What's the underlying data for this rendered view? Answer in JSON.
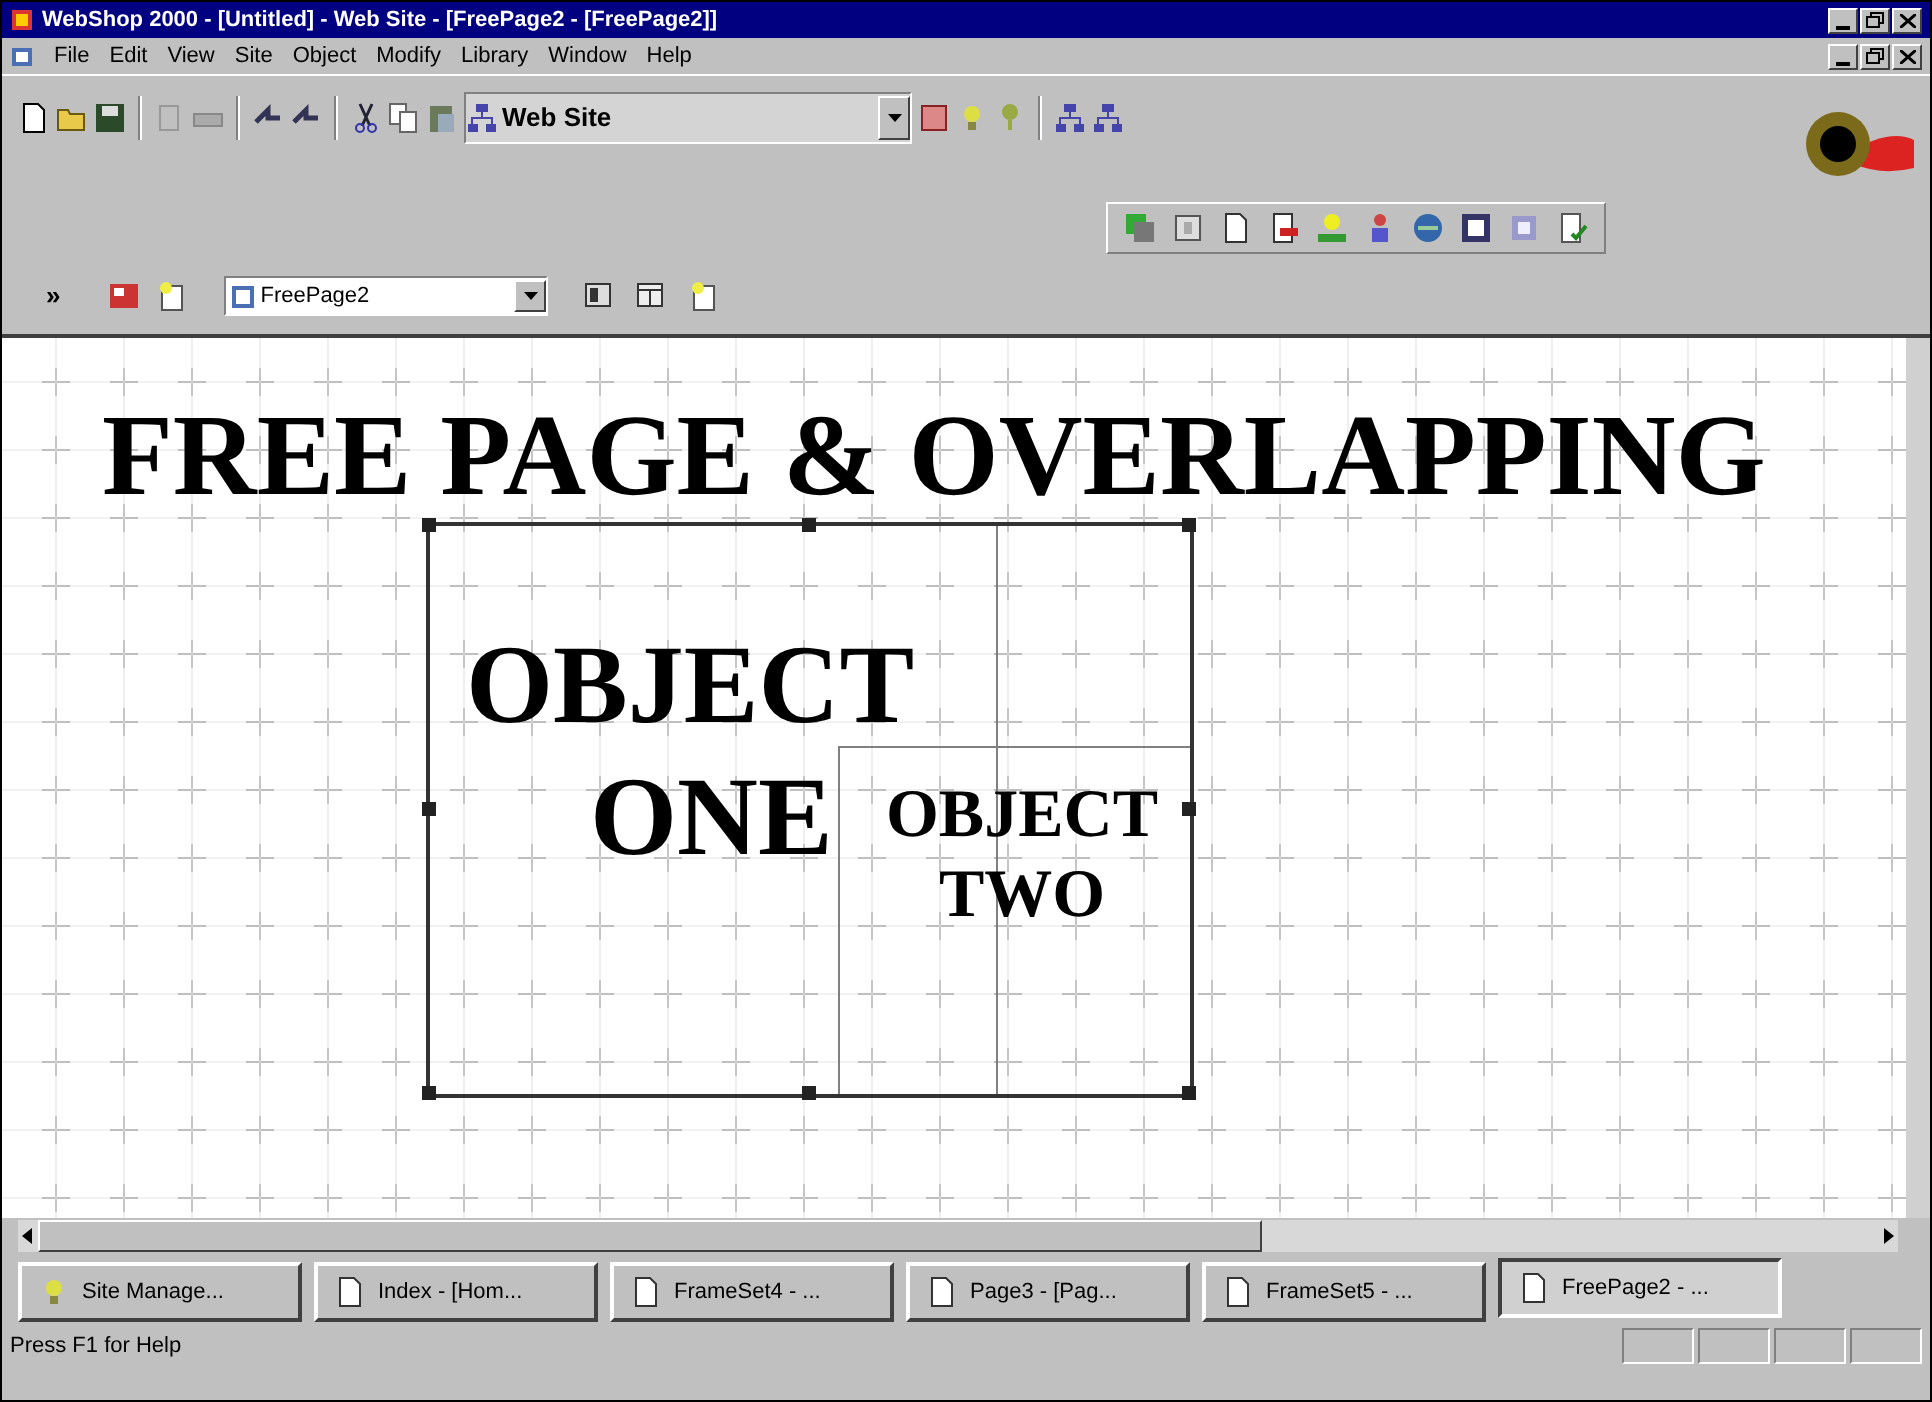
{
  "window": {
    "title": "WebShop 2000 - [Untitled] - Web Site - [FreePage2 - [FreePage2]]"
  },
  "menu": [
    "File",
    "Edit",
    "View",
    "Site",
    "Object",
    "Modify",
    "Library",
    "Window",
    "Help"
  ],
  "toolbar": {
    "view_combo": "Web Site"
  },
  "page_bar": {
    "chevron": "»",
    "page_combo": "FreePage2"
  },
  "canvas": {
    "heading": "FREE PAGE & OVERLAPPING",
    "objects": [
      {
        "lines": [
          "OBJECT",
          "ONE"
        ]
      },
      {
        "lines": [
          "OBJECT",
          "TWO"
        ]
      }
    ]
  },
  "tabs": [
    {
      "label": "Site Manage...",
      "selected": false
    },
    {
      "label": "Index - [Hom...",
      "selected": false
    },
    {
      "label": "FrameSet4 - ...",
      "selected": false
    },
    {
      "label": "Page3 - [Pag...",
      "selected": false
    },
    {
      "label": "FrameSet5 - ...",
      "selected": false
    },
    {
      "label": "FreePage2 - ...",
      "selected": true
    }
  ],
  "status_bar": {
    "text": "Press F1 for Help"
  }
}
